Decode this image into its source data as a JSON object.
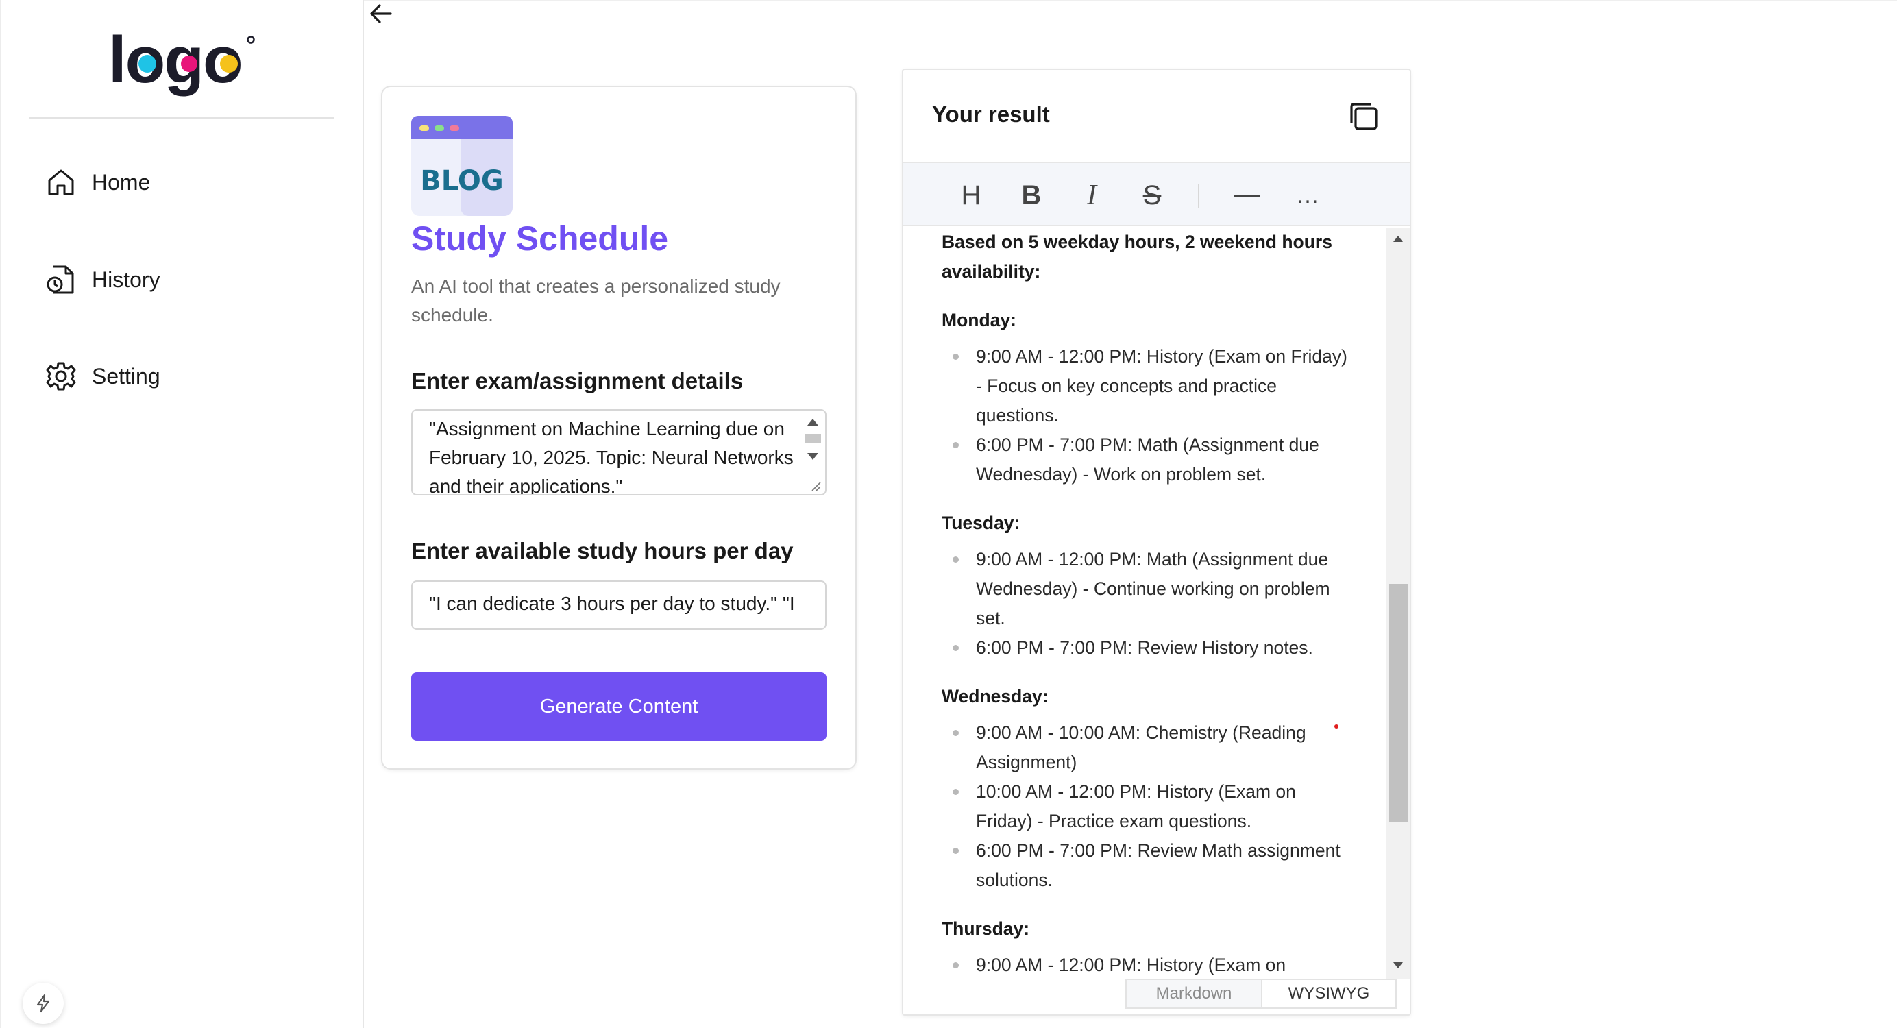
{
  "sidebar": {
    "logo_text": "logo",
    "items": [
      {
        "label": "Home",
        "icon": "home-icon"
      },
      {
        "label": "History",
        "icon": "history-icon"
      },
      {
        "label": "Setting",
        "icon": "gear-icon"
      }
    ]
  },
  "tool": {
    "icon_label": "BLOG",
    "title": "Study Schedule",
    "description": "An AI tool that creates a personalized study schedule.",
    "exam_label": "Enter exam/assignment details",
    "exam_value": "\"Assignment on Machine Learning due on February 10, 2025. Topic: Neural Networks and their applications.\"",
    "hours_label": "Enter available study hours per day",
    "hours_value": "\"I can dedicate 3 hours per day to study.\" \"I",
    "generate_label": "Generate Content"
  },
  "result": {
    "title": "Your result",
    "intro": "Based on 5 weekday hours, 2 weekend hours availability:",
    "days": [
      {
        "name": "Monday:",
        "items": [
          "9:00 AM - 12:00 PM: History (Exam on Friday) - Focus on key concepts and practice questions.",
          "6:00 PM - 7:00 PM: Math (Assignment due Wednesday) - Work on problem set."
        ]
      },
      {
        "name": "Tuesday:",
        "items": [
          "9:00 AM - 12:00 PM:  Math (Assignment due Wednesday) - Continue working on problem set.",
          "6:00 PM - 7:00 PM: Review History notes."
        ]
      },
      {
        "name": "Wednesday:",
        "items": [
          "9:00 AM - 10:00 AM:  Chemistry (Reading Assignment)",
          "10:00 AM - 12:00 PM:  History (Exam on Friday) - Practice exam questions.",
          "6:00 PM - 7:00 PM: Review Math assignment solutions."
        ]
      },
      {
        "name": "Thursday:",
        "items": [
          "9:00 AM - 12:00 PM: History (Exam on"
        ]
      }
    ],
    "toolbar": {
      "heading": "H",
      "bold": "B",
      "italic": "I",
      "strike": "S",
      "more": "…"
    },
    "modes": {
      "markdown": "Markdown",
      "wysiwyg": "WYSIWYG"
    }
  },
  "colors": {
    "accent": "#7050f2",
    "logo_cyan": "#1fc3e6",
    "logo_magenta": "#e8147a",
    "logo_yellow": "#f5c21b"
  }
}
